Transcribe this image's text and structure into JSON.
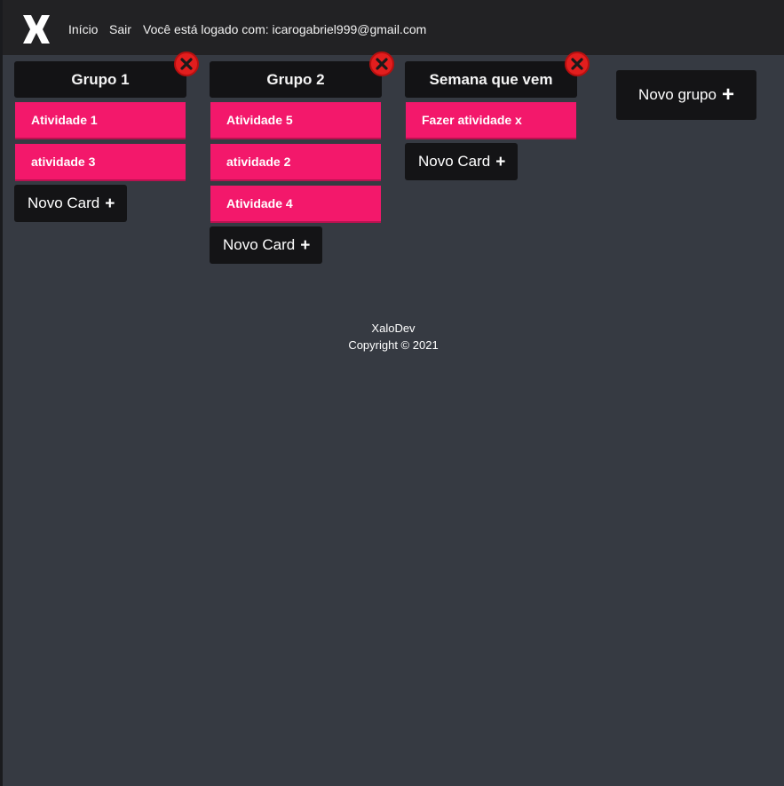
{
  "navbar": {
    "home_label": "Início",
    "logout_label": "Sair",
    "user_text": "Você está logado com: icarogabriel999@gmail.com"
  },
  "groups": [
    {
      "title": "Grupo 1",
      "cards": [
        "Atividade 1",
        "atividade 3"
      ],
      "new_card_label": "Novo Card"
    },
    {
      "title": "Grupo 2",
      "cards": [
        "Atividade 5",
        "atividade 2",
        "Atividade 4"
      ],
      "new_card_label": "Novo Card"
    },
    {
      "title": "Semana que vem",
      "cards": [
        "Fazer atividade x"
      ],
      "new_card_label": "Novo Card"
    }
  ],
  "new_group_label": "Novo grupo",
  "footer": {
    "brand": "XaloDev",
    "copyright": "Copyright © 2021"
  },
  "colors": {
    "background": "#363a42",
    "navbar": "#222224",
    "card": "#f3186b",
    "delete": "#e21e1e",
    "button": "#141416"
  }
}
